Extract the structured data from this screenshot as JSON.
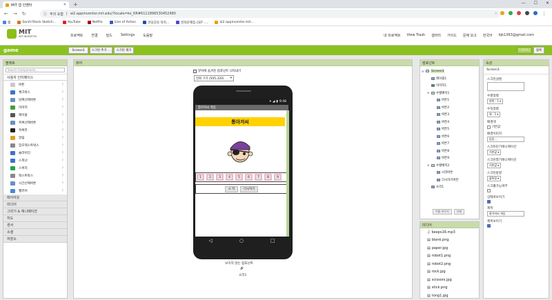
{
  "browser": {
    "tab_title": "MIT 앱 인벤터",
    "new_tab": "+",
    "window_controls": [
      "—",
      "☐",
      "✕"
    ],
    "security": "주의 요함",
    "url": "ai2.appinventor.mit.edu/?locale=ko_KR#6111896530452480",
    "bookmarks": [
      "앱",
      "Sarsh!Stock Sketch...",
      "YouTube",
      "Netflix",
      "Line of Action",
      "코딩강의 허지...",
      "전자문제집 CBT -...",
      "ai2.appinventor.mit..."
    ]
  },
  "header": {
    "logo_title": "MIT",
    "logo_subtitle": "APP INVENTOR",
    "menu": [
      "프로젝트",
      "연결",
      "빌드",
      "Settings",
      "도움말"
    ],
    "right_menu": [
      "내 프로젝트",
      "View Trash",
      "갤러리",
      "가이드",
      "문제 보고",
      "한국어",
      "bjk1363@gmail.com"
    ]
  },
  "toolbar": {
    "project_name": "game",
    "screen_select": "Screen3",
    "add_screen": "스크린 추가 ...",
    "remove_screen": "스크린 제거",
    "designer": "디자이너",
    "blocks": "블록"
  },
  "palette": {
    "title": "팔레트",
    "search_placeholder": "Search Components...",
    "user_interface_title": "사용자 인터페이스",
    "items": [
      "버튼",
      "체크박스",
      "날짜선택버튼",
      "이미지",
      "레이블",
      "목록선택버튼",
      "목록뷰",
      "알림",
      "암호텍스트박스",
      "슬라이더",
      "스피너",
      "스위치",
      "텍스트박스",
      "시간선택버튼",
      "웹뷰어"
    ],
    "help": "?",
    "categories": [
      "레이아웃",
      "미디어",
      "그리기 & 애니메이션",
      "지도",
      "센서",
      "소셜",
      "저장소"
    ]
  },
  "viewer": {
    "title": "뷰어",
    "hidden_check": "뷰어에 숨겨진 컴포넌트 나타내기",
    "size_select": "전화 크기 (505,320)",
    "status_time": "9:48",
    "app_title": "통아저씨 게임",
    "heading": "통아저씨",
    "numbers": [
      "1",
      "2",
      "3",
      "4",
      "5",
      "6",
      "7",
      "8",
      "9"
    ],
    "start_button": "시 작",
    "retry_button": "다시하기",
    "nav_back": "◁",
    "nav_home": "○",
    "nav_recent": "□",
    "nonvisible_label": "보이지 않는 컴포넌트",
    "sound_label": "소리1"
  },
  "components": {
    "title": "컴포넌트",
    "tree": [
      {
        "label": "Screen3",
        "depth": 0,
        "toggle": "⊟"
      },
      {
        "label": "레이블1",
        "depth": 1,
        "toggle": ""
      },
      {
        "label": "이미지1",
        "depth": 1,
        "toggle": ""
      },
      {
        "label": "수평배치1",
        "depth": 1,
        "toggle": "⊟"
      },
      {
        "label": "버튼1",
        "depth": 2,
        "toggle": ""
      },
      {
        "label": "버튼2",
        "depth": 2,
        "toggle": ""
      },
      {
        "label": "버튼3",
        "depth": 2,
        "toggle": ""
      },
      {
        "label": "버튼4",
        "depth": 2,
        "toggle": ""
      },
      {
        "label": "버튼5",
        "depth": 2,
        "toggle": ""
      },
      {
        "label": "버튼6",
        "depth": 2,
        "toggle": ""
      },
      {
        "label": "버튼7",
        "depth": 2,
        "toggle": ""
      },
      {
        "label": "버튼8",
        "depth": 2,
        "toggle": ""
      },
      {
        "label": "버튼9",
        "depth": 2,
        "toggle": ""
      },
      {
        "label": "수평배치2",
        "depth": 1,
        "toggle": "⊟"
      },
      {
        "label": "시작버튼",
        "depth": 2,
        "toggle": ""
      },
      {
        "label": "다시하기버튼",
        "depth": 2,
        "toggle": ""
      },
      {
        "label": "소리1",
        "depth": 1,
        "toggle": ""
      }
    ],
    "rename_button": "이름 바꾸기",
    "delete_button": "삭제"
  },
  "media": {
    "title": "미디어",
    "files": [
      "beeps16.mp3",
      "blank.png",
      "paper.jpg",
      "robot1.png",
      "robot2.png",
      "rock.jpg",
      "scissors.jpg",
      "stick.png",
      "tong1.jpg"
    ]
  },
  "properties": {
    "title": "속성",
    "screen": "Screen3",
    "items": [
      {
        "label": "스크린설명",
        "type": "textarea",
        "value": ""
      },
      {
        "label": "수평정렬",
        "type": "dropdown",
        "value": "왼쪽 : 1 ▾"
      },
      {
        "label": "수직정렬",
        "type": "dropdown",
        "value": "위 : 1 ▾"
      },
      {
        "label": "배경색",
        "type": "color",
        "value": "기본값"
      },
      {
        "label": "배경이미지",
        "type": "input",
        "value": "없음..."
      },
      {
        "label": "스크린닫기애니메이션",
        "type": "dropdown",
        "value": "기본값 ▾"
      },
      {
        "label": "스크린열기애니메이션",
        "type": "dropdown",
        "value": "기본값 ▾"
      },
      {
        "label": "스크린방향",
        "type": "dropdown",
        "value": "불특정 ▾"
      },
      {
        "label": "스크롤가능여부",
        "type": "checkbox",
        "checked": false
      },
      {
        "label": "상태바보이기",
        "type": "checkbox",
        "checked": true
      },
      {
        "label": "제목",
        "type": "input",
        "value": "통아저씨 게임"
      },
      {
        "label": "제목보이기",
        "type": "checkbox",
        "checked": true
      }
    ]
  }
}
